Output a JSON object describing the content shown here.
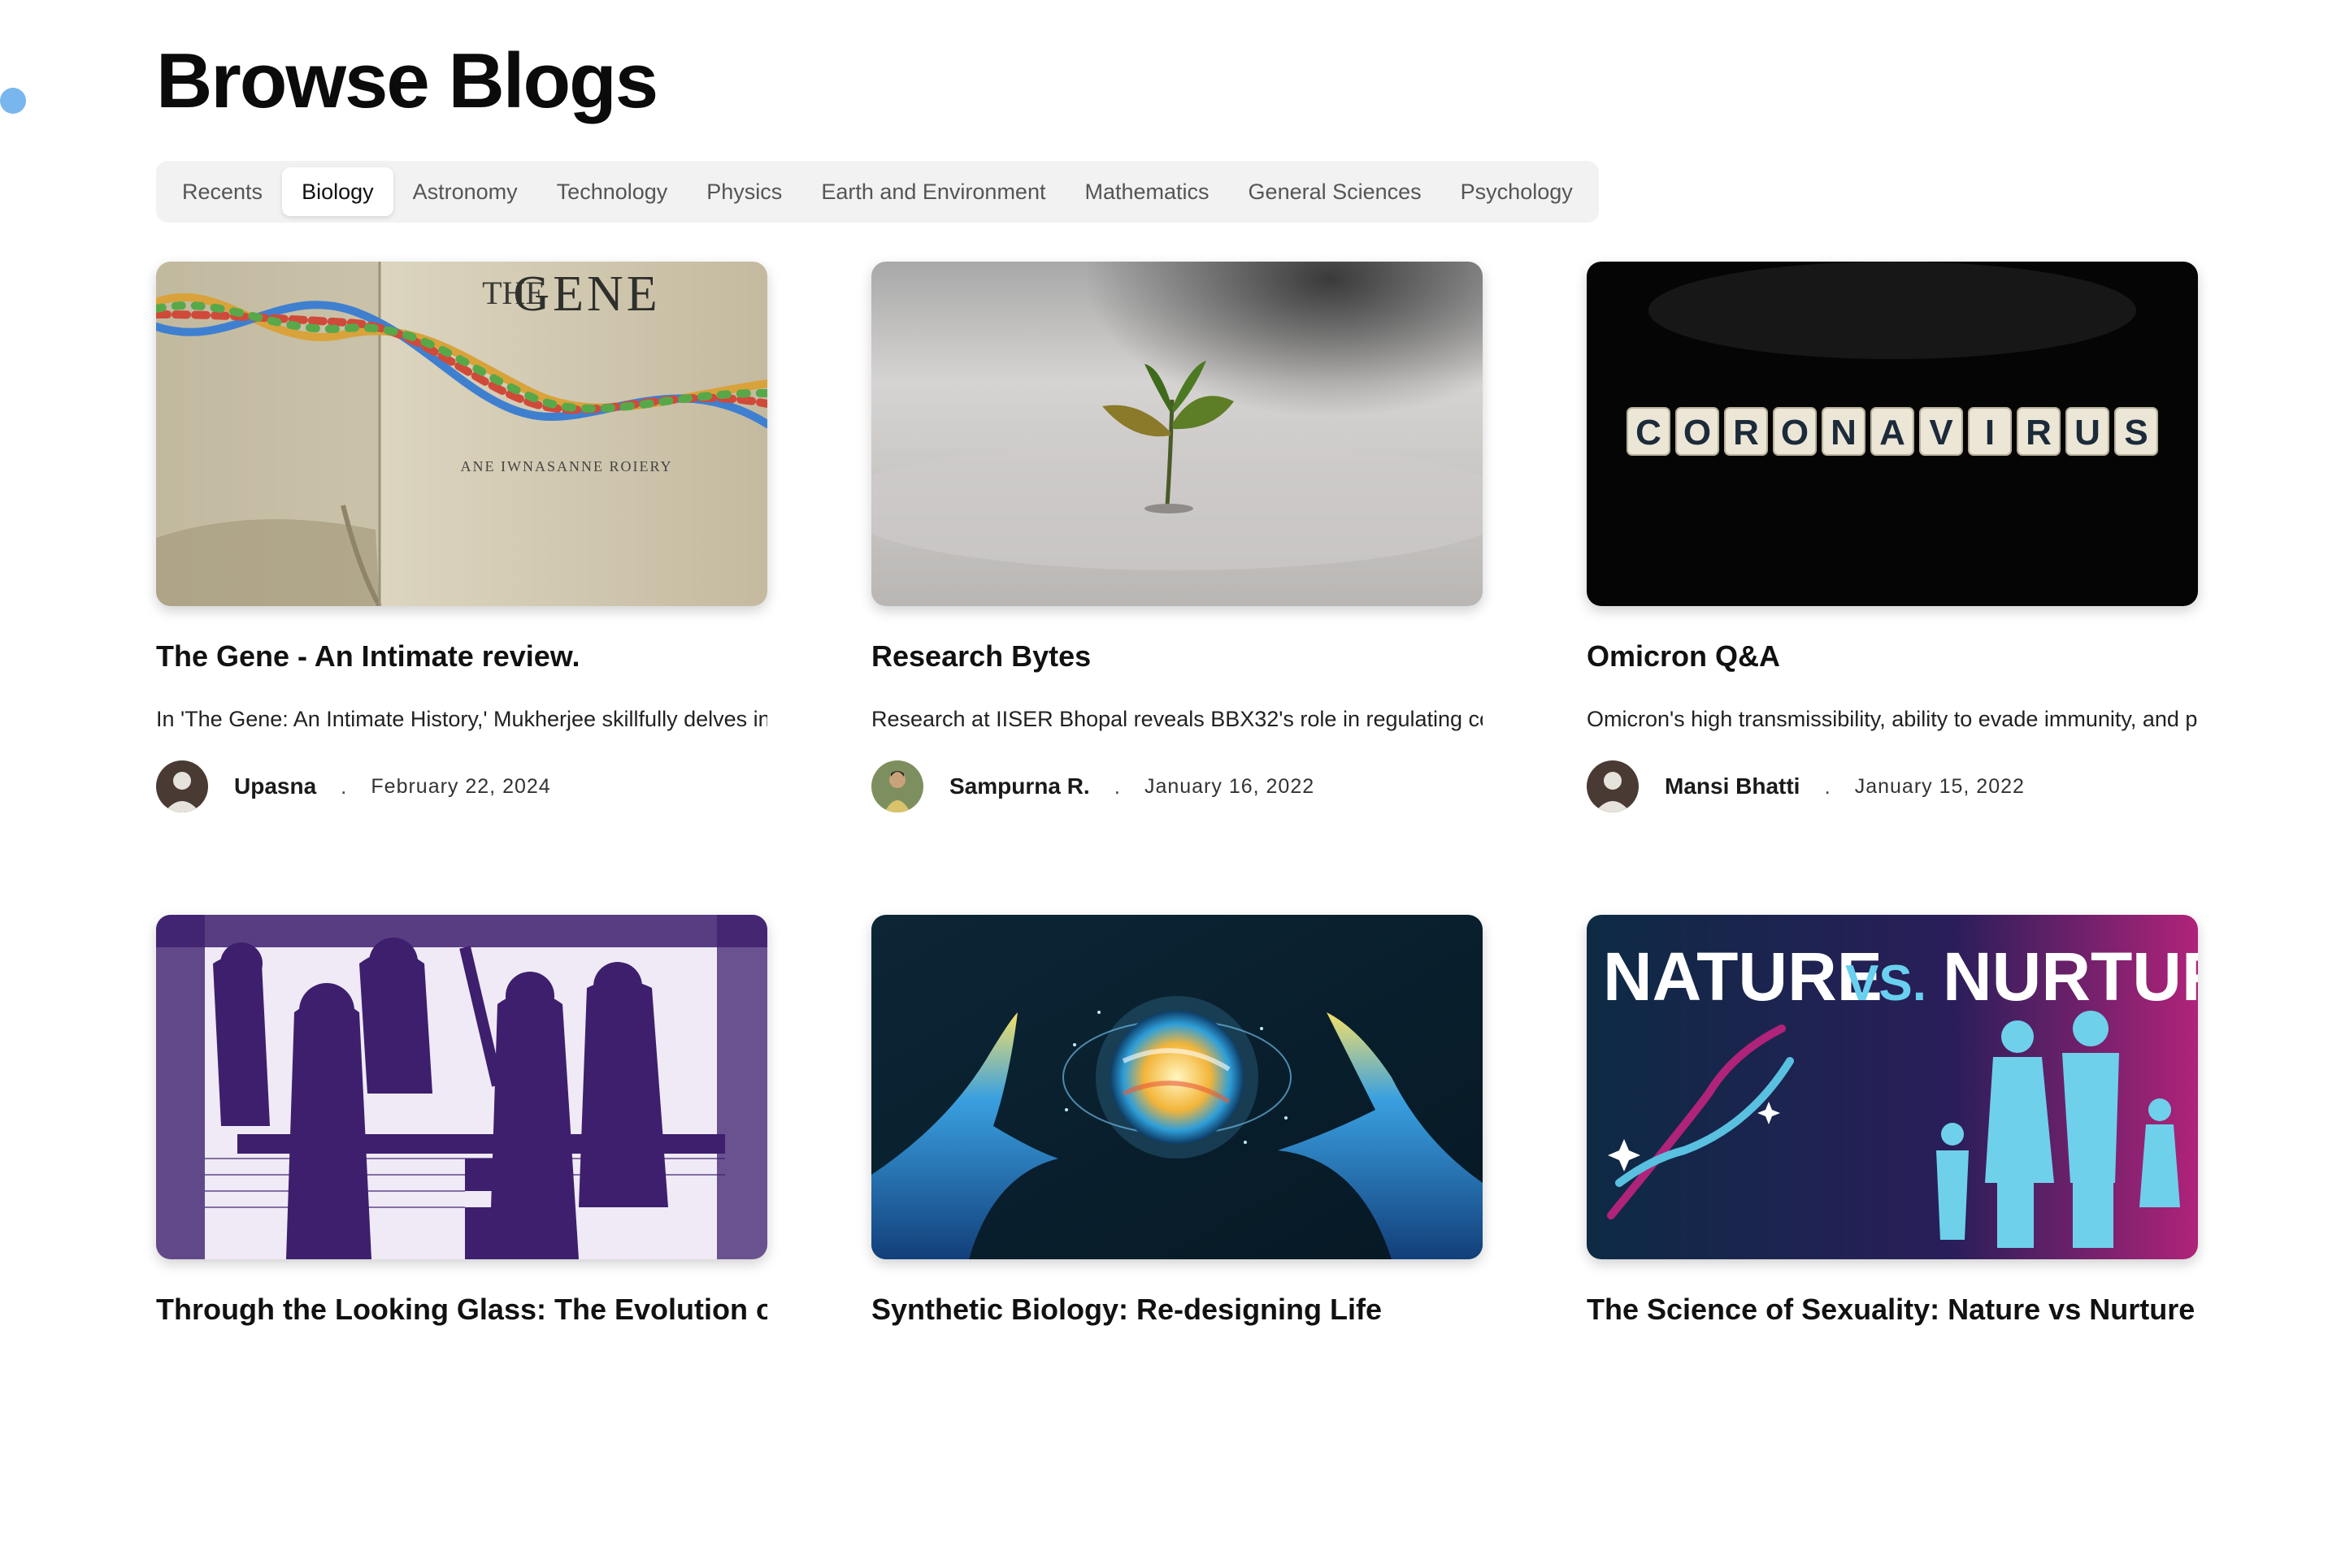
{
  "page": {
    "title": "Browse Blogs",
    "accent": "#7ab6ee"
  },
  "tabs": [
    {
      "label": "Recents",
      "active": false
    },
    {
      "label": "Biology",
      "active": true
    },
    {
      "label": "Astronomy",
      "active": false
    },
    {
      "label": "Technology",
      "active": false
    },
    {
      "label": "Physics",
      "active": false
    },
    {
      "label": "Earth and Environment",
      "active": false
    },
    {
      "label": "Mathematics",
      "active": false
    },
    {
      "label": "General Sciences",
      "active": false
    },
    {
      "label": "Psychology",
      "active": false
    }
  ],
  "posts": [
    {
      "title": "The Gene - An Intimate review.",
      "excerpt": "In 'The Gene: An Intimate History,' Mukherjee skillfully delves in...",
      "author": "Upasna",
      "separator": ".",
      "date": "February 22, 2024",
      "image": {
        "kind": "book-gene",
        "heading": "GENE",
        "subheading": "THE",
        "byline": "ANE IWNASANNE ROIERY"
      },
      "avatar": "default-avatar-icon"
    },
    {
      "title": "Research Bytes",
      "excerpt": "Research at IISER Bhopal reveals BBX32's role in regulating co...",
      "author": "Sampurna R.",
      "separator": ".",
      "date": "January 16, 2022",
      "image": {
        "kind": "seedling"
      },
      "avatar": "photo-avatar-icon"
    },
    {
      "title": "Omicron Q&A",
      "excerpt": "Omicron's high transmissibility, ability to evade immunity, and p...",
      "author": "Mansi Bhatti",
      "separator": ".",
      "date": "January 15, 2022",
      "image": {
        "kind": "letter-tiles",
        "letters": [
          "C",
          "O",
          "R",
          "O",
          "N",
          "A",
          "V",
          "I",
          "R",
          "U",
          "S"
        ]
      },
      "avatar": "default-avatar-icon"
    },
    {
      "title": "Through the Looking Glass: The Evolution of",
      "excerpt": "",
      "author": "",
      "separator": "",
      "date": "",
      "image": {
        "kind": "engraving"
      },
      "avatar": ""
    },
    {
      "title": "Synthetic Biology: Re-designing Life",
      "excerpt": "",
      "author": "",
      "separator": "",
      "date": "",
      "image": {
        "kind": "glowing-orb"
      },
      "avatar": ""
    },
    {
      "title": "The Science of Sexuality: Nature vs Nurture",
      "excerpt": "",
      "author": "",
      "separator": "",
      "date": "",
      "image": {
        "kind": "nature-vs-nurture",
        "left": "NATURE",
        "mid": "VS.",
        "right": "NURTURE"
      },
      "avatar": ""
    }
  ]
}
